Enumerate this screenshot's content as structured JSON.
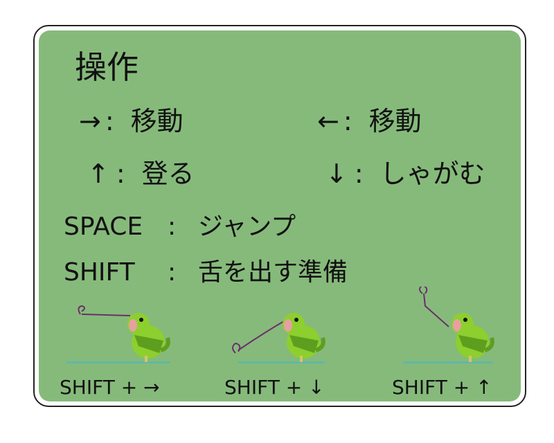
{
  "title": "操作",
  "controls": [
    {
      "key": "→",
      "sep": ":",
      "action": "移動"
    },
    {
      "key": "←",
      "sep": ":",
      "action": "移動"
    },
    {
      "key": "↑",
      "sep": ":",
      "action": "登る"
    },
    {
      "key": "↓",
      "sep": ":",
      "action": "しゃがむ"
    },
    {
      "key": "SPACE",
      "sep": ":",
      "action": "ジャンプ"
    },
    {
      "key": "SHIFT",
      "sep": ":",
      "action": "舌を出す準備"
    }
  ],
  "demos": [
    {
      "label": "SHIFT + →"
    },
    {
      "label": "SHIFT + ↓"
    },
    {
      "label": "SHIFT + ↑"
    }
  ],
  "colors": {
    "panel_bg": "#86ba7b",
    "border": "#222222",
    "ground": "#5fb8a6",
    "tongue": "#6b2e6b",
    "chameleon": "#8ccf2e"
  }
}
